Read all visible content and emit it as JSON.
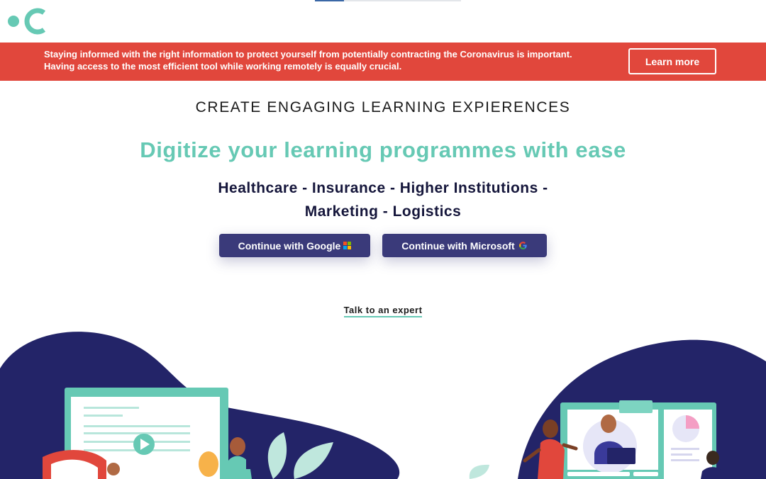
{
  "progress": {
    "fraction": 0.2
  },
  "banner": {
    "message": "Staying informed with the right information to protect yourself from potentially contracting the Coronavirus is important. Having access to the most efficient tool while working remotely is equally crucial.",
    "cta_label": "Learn more"
  },
  "hero": {
    "eyebrow": "CREATE ENGAGING LEARNING EXPIERENCES",
    "headline": "Digitize your learning programmes with ease",
    "industries_line1": "Healthcare - Insurance - Higher Institutions -",
    "industries_line2": "Marketing - Logistics"
  },
  "auth": {
    "google_label": "Continue with Google",
    "google_icon": "microsoft-logo-icon",
    "microsoft_label": "Continue with Microsoft",
    "microsoft_icon": "google-g-icon"
  },
  "expert_link": "Talk to an expert",
  "colors": {
    "brand_teal": "#66c9b4",
    "banner_red": "#e1473c",
    "button_navy": "#3a3a7a",
    "illustration_navy": "#232468",
    "ink": "#15163b"
  }
}
